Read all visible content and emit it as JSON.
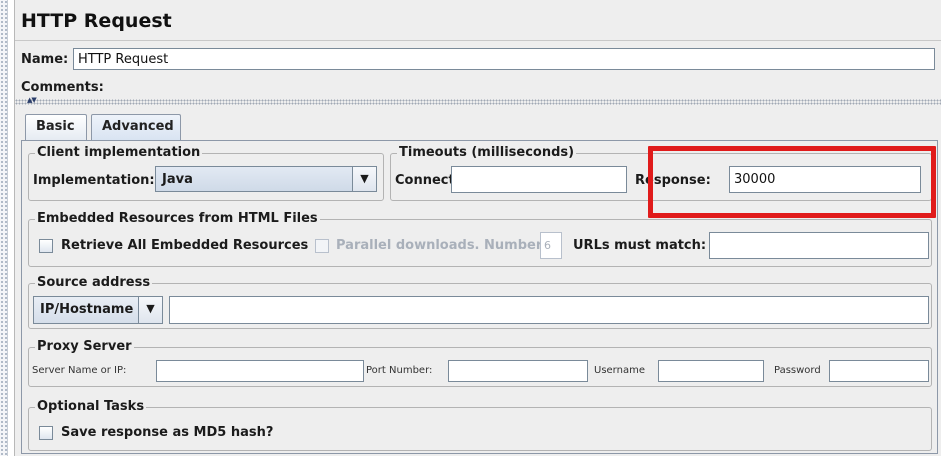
{
  "panel": {
    "title": "HTTP Request",
    "name_label": "Name:",
    "name_value": "HTTP Request",
    "comments_label": "Comments:"
  },
  "tabs": [
    {
      "label": "Basic",
      "active": false
    },
    {
      "label": "Advanced",
      "active": true
    }
  ],
  "client_implementation": {
    "group_title": "Client implementation",
    "label": "Implementation:",
    "selected": "Java"
  },
  "timeouts": {
    "group_title": "Timeouts (milliseconds)",
    "connect_label": "Connect:",
    "connect_value": "",
    "response_label": "Response:",
    "response_value": "30000"
  },
  "embedded": {
    "group_title": "Embedded Resources from HTML Files",
    "retrieve_label": "Retrieve All Embedded Resources",
    "retrieve_checked": false,
    "parallel_label": "Parallel downloads. Number:",
    "parallel_value": "6",
    "urls_label": "URLs must match:",
    "urls_value": ""
  },
  "source_address": {
    "group_title": "Source address",
    "type_selected": "IP/Hostname",
    "value": ""
  },
  "proxy": {
    "group_title": "Proxy Server",
    "server_label": "Server Name or IP:",
    "port_label": "Port Number:",
    "username_label": "Username",
    "password_label": "Password"
  },
  "optional_tasks": {
    "group_title": "Optional Tasks",
    "md5_label": "Save response as MD5 hash?",
    "md5_checked": false
  },
  "colors": {
    "highlight": "#e01b1b",
    "panel_bg": "#eeeeee",
    "field_border": "#7a8a99"
  },
  "icons": {
    "combo_arrow": "chevron-down-icon",
    "divider_arrows": "collapse-expand-icon"
  }
}
